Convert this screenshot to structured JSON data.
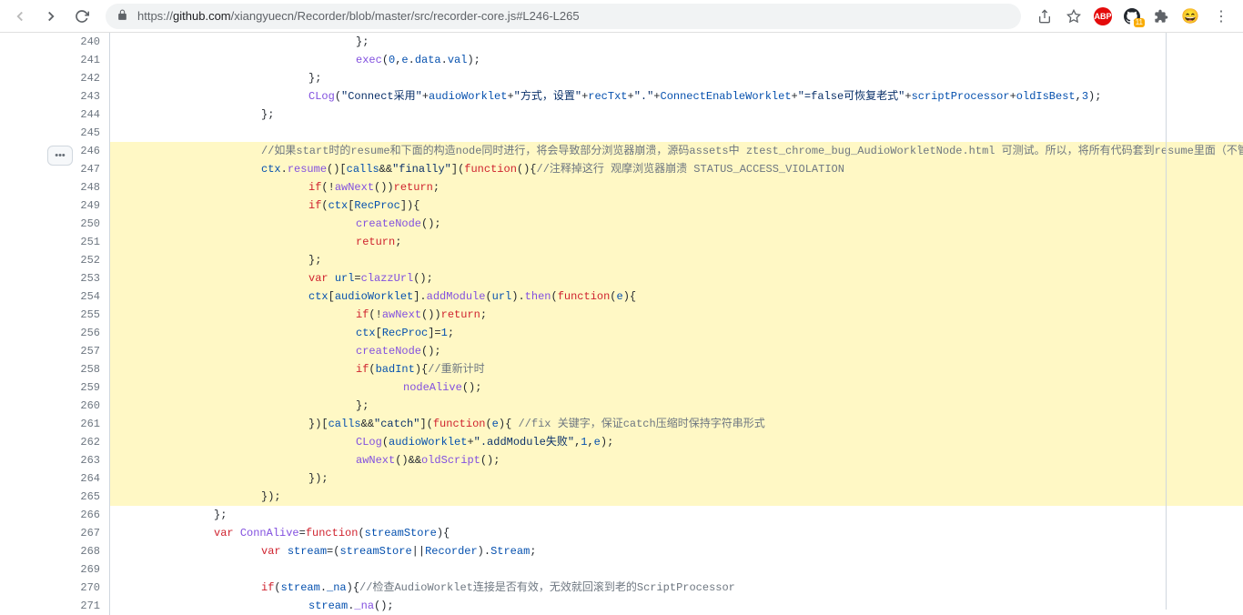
{
  "url": "https://github.com/xiangyuecn/Recorder/blob/master/src/recorder-core.js#L246-L265",
  "url_host": "github.com",
  "url_path": "/xiangyuecn/Recorder/blob/master/src/recorder-core.js#L246-L265",
  "ext": {
    "abp": "ABP",
    "gh_badge": "11"
  },
  "lines": {
    "240": {
      "hl": false,
      "html": "\t\t\t\t\t};"
    },
    "241": {
      "hl": false,
      "html": "\t\t\t\t\t<span class='c-func'>exec</span>(<span class='c-num'>0</span>,<span class='c-prop'>e</span>.<span class='c-prop'>data</span>.<span class='c-prop'>val</span>);"
    },
    "242": {
      "hl": false,
      "html": "\t\t\t\t};"
    },
    "243": {
      "hl": false,
      "html": "\t\t\t\t<span class='c-func'>CLog</span>(<span class='c-string'>\"Connect采用\"</span>+<span class='c-prop'>audioWorklet</span>+<span class='c-string'>\"方式，设置\"</span>+<span class='c-prop'>recTxt</span>+<span class='c-string'>\".\"</span>+<span class='c-const'>ConnectEnableWorklet</span>+<span class='c-string'>\"=false可恢复老式\"</span>+<span class='c-prop'>scriptProcessor</span>+<span class='c-prop'>oldIsBest</span>,<span class='c-num'>3</span>);"
    },
    "244": {
      "hl": false,
      "html": "\t\t\t};"
    },
    "245": {
      "hl": false,
      "html": "\t\t\t"
    },
    "246": {
      "hl": true,
      "html": "\t\t\t<span class='c-comment'>//如果start时的resume和下面的构造node同时进行，将会导致部分浏览器崩溃，源码assets中 ztest_chrome_bug_AudioWorkletNode.html 可测试。所以，将所有代码套到resume里面（不管catch），</span>"
    },
    "247": {
      "hl": true,
      "html": "\t\t\t<span class='c-prop'>ctx</span>.<span class='c-func'>resume</span>()[<span class='c-prop'>calls</span>&&<span class='c-string'>\"finally\"</span>](<span class='c-keyword'>function</span>(){<span class='c-comment'>//注释掉这行 观摩浏览器崩溃 STATUS_ACCESS_VIOLATION</span>"
    },
    "248": {
      "hl": true,
      "html": "\t\t\t\t<span class='c-keyword'>if</span>(!<span class='c-func'>awNext</span>())<span class='c-keyword'>return</span>;"
    },
    "249": {
      "hl": true,
      "html": "\t\t\t\t<span class='c-keyword'>if</span>(<span class='c-prop'>ctx</span>[<span class='c-const'>RecProc</span>]){"
    },
    "250": {
      "hl": true,
      "html": "\t\t\t\t\t<span class='c-func'>createNode</span>();"
    },
    "251": {
      "hl": true,
      "html": "\t\t\t\t\t<span class='c-keyword'>return</span>;"
    },
    "252": {
      "hl": true,
      "html": "\t\t\t\t};"
    },
    "253": {
      "hl": true,
      "html": "\t\t\t\t<span class='c-keyword'>var</span> <span class='c-prop'>url</span>=<span class='c-func'>clazzUrl</span>();"
    },
    "254": {
      "hl": true,
      "html": "\t\t\t\t<span class='c-prop'>ctx</span>[<span class='c-prop'>audioWorklet</span>].<span class='c-func'>addModule</span>(<span class='c-prop'>url</span>).<span class='c-func'>then</span>(<span class='c-keyword'>function</span>(<span class='c-prop'>e</span>){"
    },
    "255": {
      "hl": true,
      "html": "\t\t\t\t\t<span class='c-keyword'>if</span>(!<span class='c-func'>awNext</span>())<span class='c-keyword'>return</span>;"
    },
    "256": {
      "hl": true,
      "html": "\t\t\t\t\t<span class='c-prop'>ctx</span>[<span class='c-const'>RecProc</span>]=<span class='c-num'>1</span>;"
    },
    "257": {
      "hl": true,
      "html": "\t\t\t\t\t<span class='c-func'>createNode</span>();"
    },
    "258": {
      "hl": true,
      "html": "\t\t\t\t\t<span class='c-keyword'>if</span>(<span class='c-prop'>badInt</span>){<span class='c-comment'>//重新计时</span>"
    },
    "259": {
      "hl": true,
      "html": "\t\t\t\t\t\t<span class='c-func'>nodeAlive</span>();"
    },
    "260": {
      "hl": true,
      "html": "\t\t\t\t\t};"
    },
    "261": {
      "hl": true,
      "html": "\t\t\t\t})[<span class='c-prop'>calls</span>&&<span class='c-string'>\"catch\"</span>](<span class='c-keyword'>function</span>(<span class='c-prop'>e</span>){ <span class='c-comment'>//fix 关键字，保证catch压缩时保持字符串形式</span>"
    },
    "262": {
      "hl": true,
      "html": "\t\t\t\t\t<span class='c-func'>CLog</span>(<span class='c-prop'>audioWorklet</span>+<span class='c-string'>\".addModule失败\"</span>,<span class='c-num'>1</span>,<span class='c-prop'>e</span>);"
    },
    "263": {
      "hl": true,
      "html": "\t\t\t\t\t<span class='c-func'>awNext</span>()&&<span class='c-func'>oldScript</span>();"
    },
    "264": {
      "hl": true,
      "html": "\t\t\t\t});"
    },
    "265": {
      "hl": true,
      "html": "\t\t\t});"
    },
    "266": {
      "hl": false,
      "html": "\t\t};"
    },
    "267": {
      "hl": false,
      "html": "\t\t<span class='c-keyword'>var</span> <span class='c-func'>ConnAlive</span>=<span class='c-keyword'>function</span>(<span class='c-prop'>streamStore</span>){"
    },
    "268": {
      "hl": false,
      "html": "\t\t\t<span class='c-keyword'>var</span> <span class='c-prop'>stream</span>=(<span class='c-prop'>streamStore</span>||<span class='c-const'>Recorder</span>).<span class='c-const'>Stream</span>;"
    },
    "269": {
      "hl": false,
      "html": "\t\t\t"
    },
    "270": {
      "hl": false,
      "html": "\t\t\t<span class='c-keyword'>if</span>(<span class='c-prop'>stream</span>.<span class='c-prop'>_na</span>){<span class='c-comment'>//检查AudioWorklet连接是否有效，无效就回滚到老的ScriptProcessor</span>"
    },
    "271": {
      "hl": false,
      "html": "\t\t\t\t<span class='c-prop'>stream</span>.<span class='c-func'>_na</span>();"
    }
  },
  "line_start": 240,
  "line_end": 271
}
